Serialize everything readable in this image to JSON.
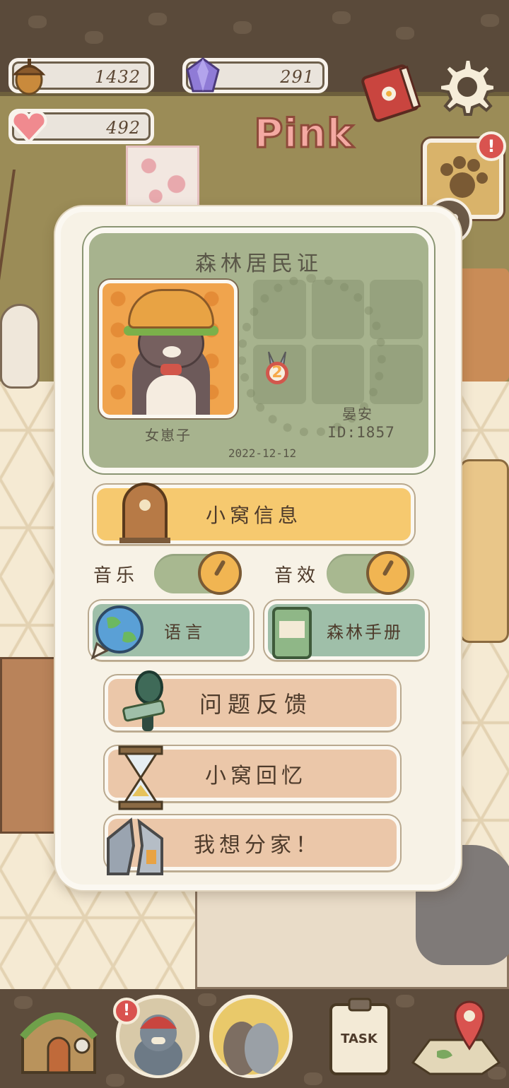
{
  "resources": {
    "acorn": {
      "value": "1432",
      "icon": "acorn-icon"
    },
    "gem": {
      "value": "291",
      "icon": "gem-icon"
    },
    "heart": {
      "value": "492",
      "icon": "heart-icon"
    }
  },
  "header": {
    "title": "Pink",
    "notification_badge": "!"
  },
  "id_card": {
    "title": "森林居民证",
    "nickname": "女崽子",
    "level": "2",
    "player_name": "晏安",
    "player_id": "ID:1857",
    "join_date": "2022-12-12"
  },
  "menu": {
    "house_info": "小窝信息",
    "music_label": "音乐",
    "sfx_label": "音效",
    "language": "语言",
    "forest_guide": "森林手册",
    "feedback": "问题反馈",
    "memories": "小窝回忆",
    "split_home": "我想分家！"
  },
  "toggles": {
    "music_on": true,
    "sfx_on": true
  },
  "bottom_nav": {
    "task_label": "TASK",
    "character_badge": "!"
  },
  "colors": {
    "card_green": "#a7b38e",
    "house_button": "#f6c96f",
    "language_button": "#9fbfa9",
    "action_button": "#ebc7a9",
    "alert_red": "#d9534f"
  }
}
